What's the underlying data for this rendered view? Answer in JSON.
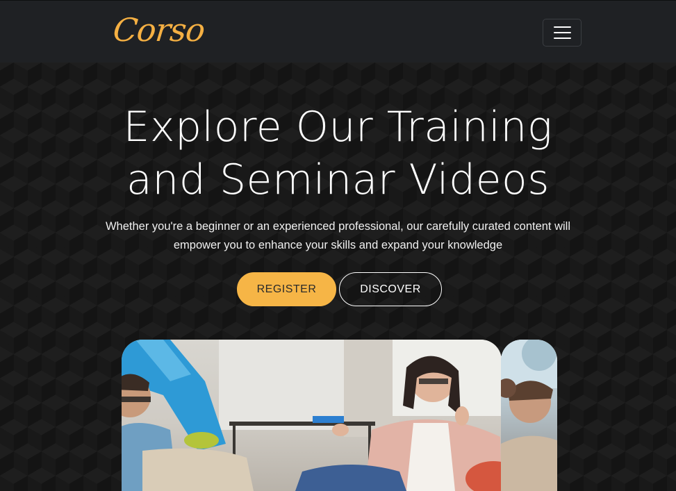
{
  "navbar": {
    "brand": "Corso",
    "menu_icon": "hamburger-menu-icon"
  },
  "hero": {
    "title_line1": "Explore Our Training",
    "title_line2": "and Seminar Videos",
    "subtitle": "Whether you're a beginner or an experienced professional, our carefully curated content will empower you to enhance your skills and expand your knowledge",
    "register_label": "REGISTER",
    "discover_label": "DISCOVER"
  },
  "colors": {
    "accent": "#f6b546",
    "navbar_bg": "#1f2124",
    "hero_bg": "#141414"
  }
}
